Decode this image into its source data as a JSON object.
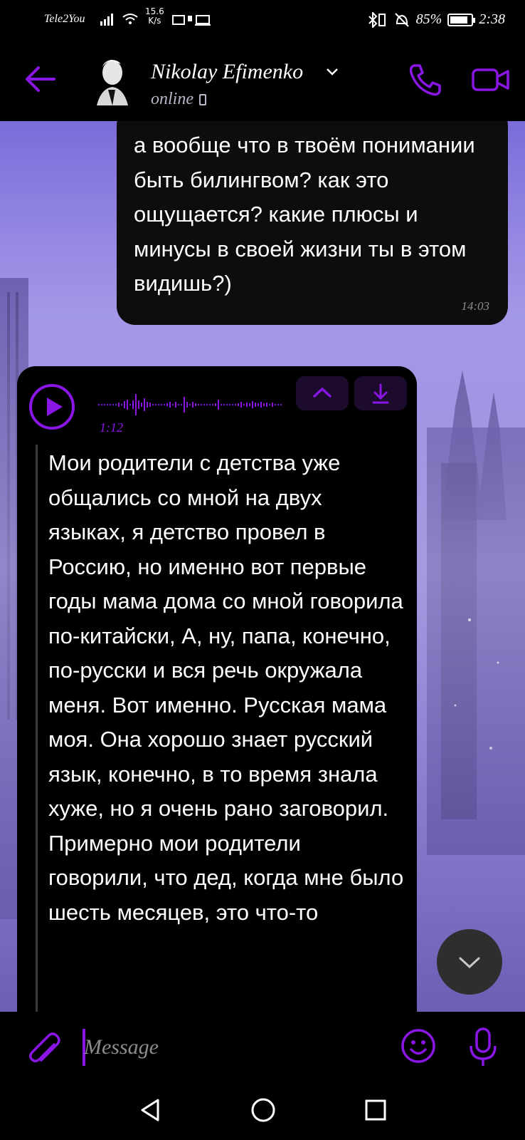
{
  "status_bar": {
    "carrier": "Tele2You",
    "speed_value": "15.6",
    "speed_unit": "K/s",
    "battery": "85%",
    "battery_level": 0.85,
    "time": "2:38"
  },
  "header": {
    "contact_name": "Nikolay Efimenko",
    "status": "online"
  },
  "messages": {
    "outgoing": {
      "text": "а вообще что в твоём понимании быть билингвом? как это ощущается? какие плюсы и минусы в своей жизни ты в этом видишь?)",
      "time": "14:03"
    },
    "voice": {
      "duration": "1:12",
      "transcript": "Мои родители с детства уже общались со мной на двух языках, я детство провел в Россию, но именно вот первые годы мама дома со мной говорила по-китайски, А, ну, папа, конечно, по-русски и вся речь окружала меня. Вот именно. Русская мама моя. Она хорошо знает русский язык, конечно, в то время знала хуже, но я очень рано заговорил. Примерно мои родители говорили, что дед, когда мне было шесть месяцев, это что-то"
    }
  },
  "input": {
    "placeholder": "Message"
  },
  "colors": {
    "accent": "#8a16e6",
    "bubble": "#0d0d0d",
    "background_top": "#9b8fe5",
    "background_bottom": "#5f4fa7"
  },
  "icons": {
    "back": "arrow-left-icon",
    "call": "phone-icon",
    "video": "video-camera-icon",
    "play": "play-icon",
    "collapse": "chevron-up-icon",
    "download": "download-icon",
    "scroll_down": "chevron-down-icon",
    "attach": "paperclip-icon",
    "emoji": "smiley-icon",
    "mic": "microphone-icon"
  }
}
